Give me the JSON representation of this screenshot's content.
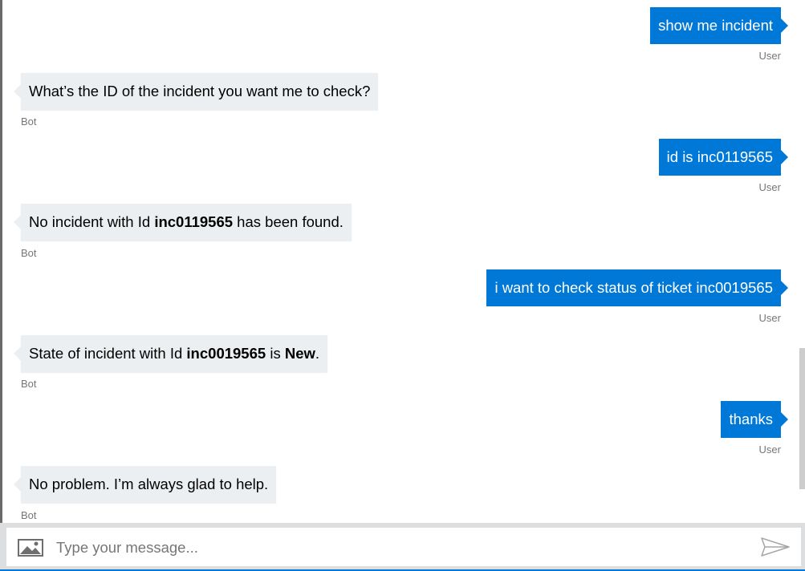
{
  "messages": [
    {
      "from": "user",
      "text": "show me incident",
      "sender_label": "User"
    },
    {
      "from": "bot",
      "text": "What’s the ID of the incident you want me to check?",
      "sender_label": "Bot"
    },
    {
      "from": "user",
      "text": "id is inc0119565",
      "sender_label": "User"
    },
    {
      "from": "bot",
      "parts": [
        "No incident with Id ",
        "inc0119565",
        " has been found."
      ],
      "sender_label": "Bot"
    },
    {
      "from": "user",
      "text": "i want to check status of ticket inc0019565",
      "sender_label": "User"
    },
    {
      "from": "bot",
      "parts": [
        "State of incident with Id ",
        "inc0019565",
        " is ",
        "New",
        "."
      ],
      "sender_label": "Bot"
    },
    {
      "from": "user",
      "text": "thanks",
      "sender_label": "User"
    },
    {
      "from": "bot",
      "text": "No problem. I’m always glad to help.",
      "sender_label": "Bot"
    }
  ],
  "composer": {
    "placeholder": "Type your message...",
    "image_icon": "image-upload-icon",
    "send_icon": "send-icon"
  },
  "colors": {
    "user_bubble": "#0078d7",
    "bot_bubble": "#eceff1",
    "accent": "#0078d7"
  }
}
